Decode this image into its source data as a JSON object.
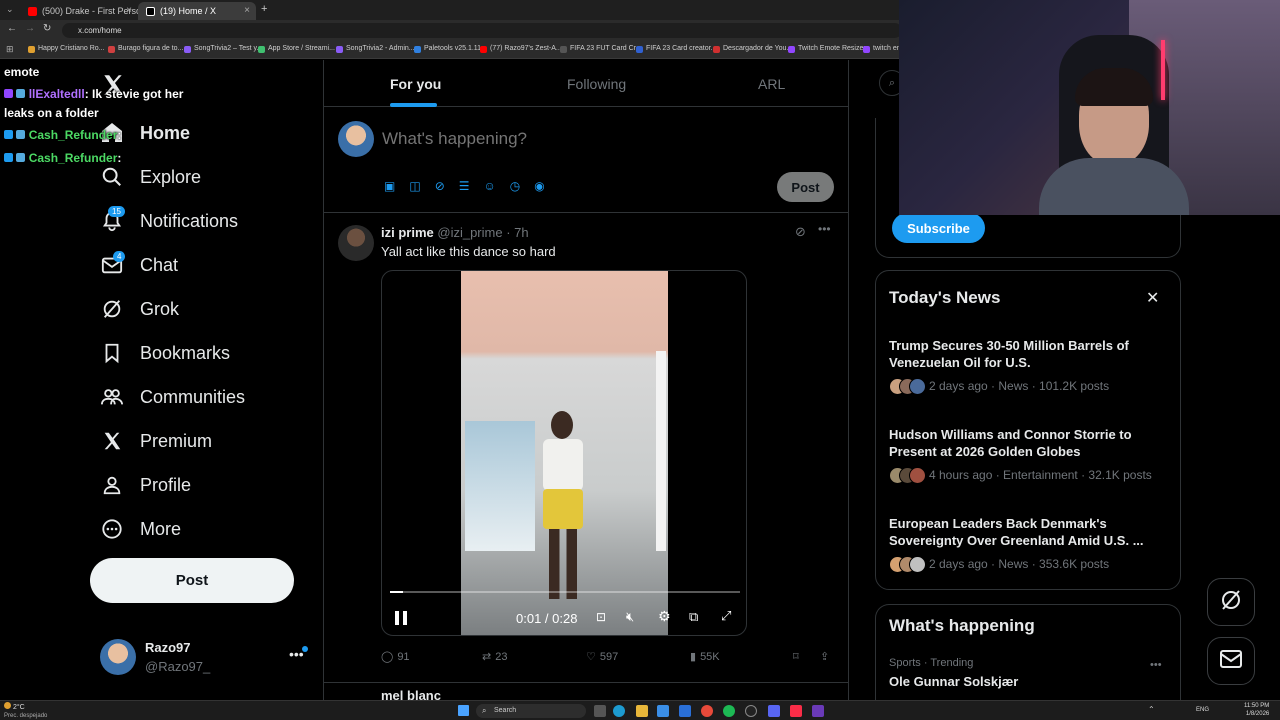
{
  "browser": {
    "tabs": [
      {
        "title": "(500) Drake - First Person Shoo",
        "color": "#ff0000"
      },
      {
        "title": "(19) Home / X",
        "color": "#ffffff"
      }
    ],
    "url": "x.com/home",
    "bookmarks": [
      {
        "label": "Happy Cristiano Ro...",
        "color": "#e0a030"
      },
      {
        "label": "Burago figura de to...",
        "color": "#d04040"
      },
      {
        "label": "SongTrivia2 – Test y...",
        "color": "#8a5cf6"
      },
      {
        "label": "App Store / Streami...",
        "color": "#40c070"
      },
      {
        "label": "SongTrivia2 - Admin...",
        "color": "#8a5cf6"
      },
      {
        "label": "Paletools v25.1.11",
        "color": "#3080e0"
      },
      {
        "label": "(77) Razo97's Zest-A...",
        "color": "#ff0000"
      },
      {
        "label": "FIFA 23 FUT Card Cr...",
        "color": "#555"
      },
      {
        "label": "FIFA 23 Card creator...",
        "color": "#3060d0"
      },
      {
        "label": "Descargador de You...",
        "color": "#d03030"
      },
      {
        "label": "Twitch Emote Resizer",
        "color": "#9146ff"
      },
      {
        "label": "twitch em",
        "color": "#9146ff"
      }
    ]
  },
  "chat": [
    {
      "line": "emote",
      "color": "#ffffff"
    },
    {
      "user": "llExaltedll",
      "msg": ": Ik stevie got her",
      "color": "#b070ff"
    },
    {
      "line": "leaks on a folder",
      "color": "#ffffff"
    },
    {
      "user": "Cash_Refunder",
      "msg": ":",
      "color": "#4cd964"
    },
    {
      "user": "Cash_Refunder",
      "msg": ":",
      "color": "#4cd964"
    }
  ],
  "nav": {
    "items": [
      {
        "label": "Home",
        "icon": "home-icon"
      },
      {
        "label": "Explore",
        "icon": "search-icon"
      },
      {
        "label": "Notifications",
        "icon": "bell-icon",
        "badge": "15"
      },
      {
        "label": "Chat",
        "icon": "mail-icon",
        "badge": "4"
      },
      {
        "label": "Grok",
        "icon": "grok-icon"
      },
      {
        "label": "Bookmarks",
        "icon": "bookmark-icon"
      },
      {
        "label": "Communities",
        "icon": "people-icon"
      },
      {
        "label": "Premium",
        "icon": "x-logo-icon"
      },
      {
        "label": "Profile",
        "icon": "person-icon"
      },
      {
        "label": "More",
        "icon": "more-circle-icon"
      }
    ],
    "post_label": "Post",
    "account": {
      "name": "Razo97",
      "handle": "@Razo97_"
    }
  },
  "feed": {
    "tabs": [
      "For you",
      "Following",
      "ARL"
    ],
    "composer": {
      "placeholder": "What's happening?",
      "post_label": "Post"
    },
    "tweet": {
      "name": "izi prime",
      "handle": "@izi_prime",
      "time": "· 7h",
      "text": "Yall act like this dance so hard",
      "video_time": "0:01 / 0:28",
      "video_progress": 0.036,
      "replies": "91",
      "reposts": "23",
      "likes": "597",
      "views": "55K"
    },
    "next_tweet_name": "mel blanc"
  },
  "right": {
    "subscribe_label": "Subscribe",
    "news_title": "Today's News",
    "news": [
      {
        "title": "Trump Secures 30-50 Million Barrels of Venezuelan Oil for U.S.",
        "meta": "2 days ago · News · 101.2K posts"
      },
      {
        "title": "Hudson Williams and Connor Storrie to Present at 2026 Golden Globes",
        "meta": "4 hours ago · Entertainment · 32.1K posts"
      },
      {
        "title": "European Leaders Back Denmark's Sovereignty Over Greenland Amid U.S. ...",
        "meta": "2 days ago · News · 353.6K posts"
      }
    ],
    "happening_title": "What's happening",
    "trend": {
      "category": "Sports · Trending",
      "name": "Ole Gunnar Solskjær"
    }
  },
  "taskbar": {
    "weather": "2°C",
    "weather_desc": "Prec. despejado",
    "search": "Search",
    "lang": "ENG",
    "time": "11:50 PM",
    "date": "1/8/2026"
  },
  "colors": {
    "accent": "#1d9bf0",
    "bg": "#000000",
    "border": "#2f3336",
    "muted": "#71767b"
  }
}
